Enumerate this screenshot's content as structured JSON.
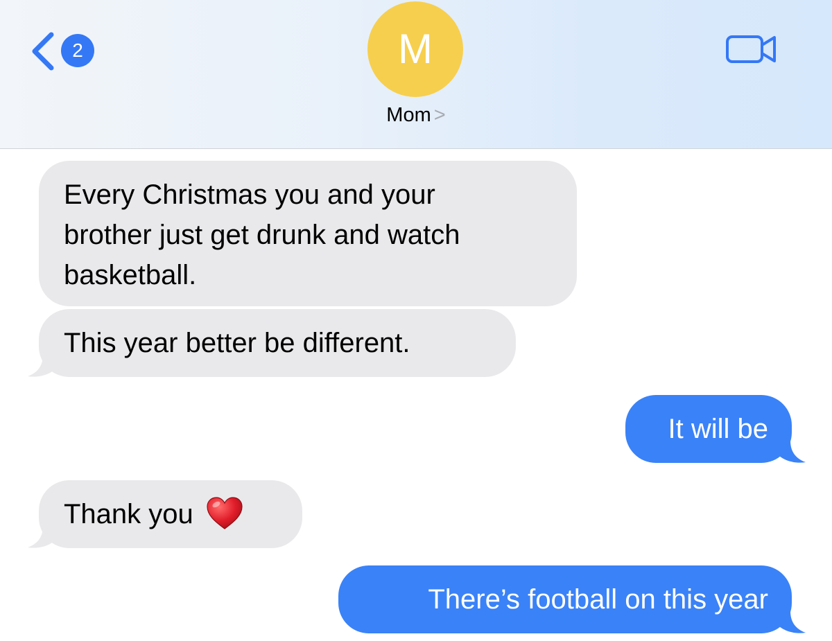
{
  "header": {
    "unread_count": "2",
    "avatar_initial": "M",
    "contact_name": "Mom",
    "name_chevron": ">"
  },
  "messages": [
    {
      "direction": "incoming",
      "text": "Every Christmas you and your\nbrother just get drunk and watch\nbasketball."
    },
    {
      "direction": "incoming",
      "text": "This year better be different."
    },
    {
      "direction": "outgoing",
      "text": "It will be"
    },
    {
      "direction": "incoming",
      "text": "Thank you",
      "emoji": "red-heart"
    },
    {
      "direction": "outgoing",
      "text": "There’s football on this year"
    }
  ],
  "colors": {
    "incoming_bubble": "#e9e9eb",
    "outgoing_bubble": "#3a82f7",
    "accent": "#3478f6",
    "avatar": "#f7cf4e"
  },
  "icons": {
    "back": "chevron-left-icon",
    "video": "video-camera-icon",
    "heart": "red-heart-icon"
  }
}
